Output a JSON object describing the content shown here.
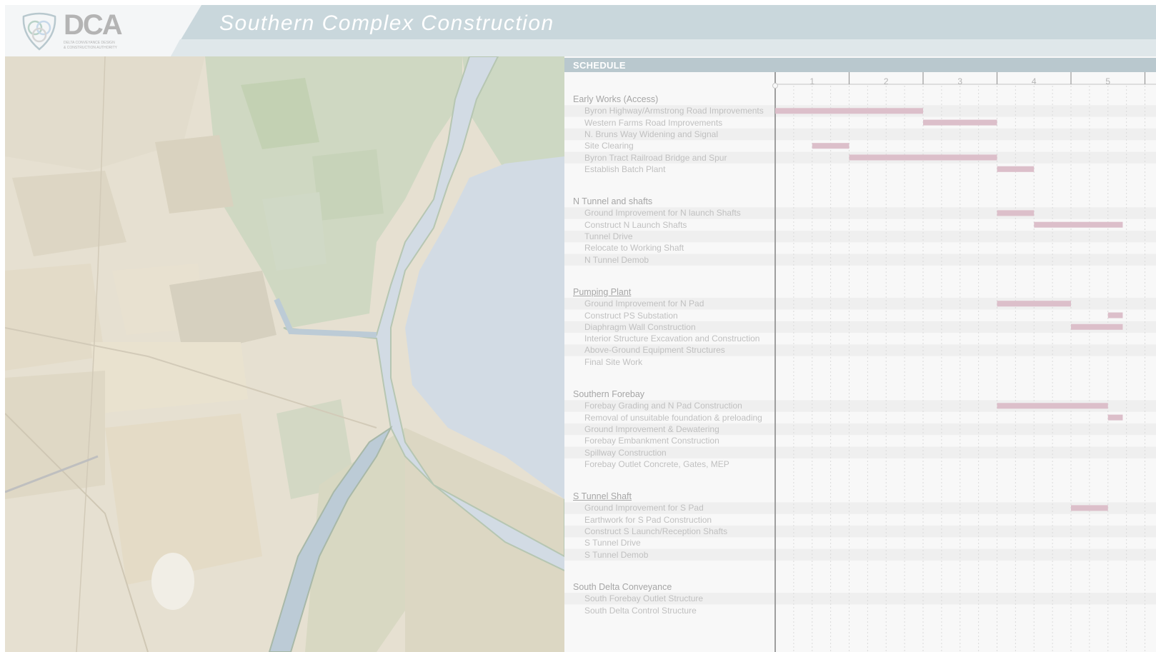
{
  "app": {
    "title": "Southern Complex Construction",
    "logo": {
      "name": "DCA",
      "subtitle_line1": "DELTA CONVEYANCE DESIGN",
      "subtitle_line2": "& CONSTRUCTION AUTHORITY"
    }
  },
  "colors": {
    "header_band": "#c9d7dc",
    "bar": "#dcbfca",
    "water": "#d2dbe4",
    "schedule_header": "#b9c8ce"
  },
  "schedule": {
    "title": "SCHEDULE",
    "periods": [
      "1",
      "2",
      "3",
      "4",
      "5"
    ],
    "groups": [
      {
        "name": "Early Works (Access)",
        "underline": false,
        "tasks": [
          {
            "name": "Byron Highway/Armstrong Road Improvements",
            "start": 0,
            "end": 2
          },
          {
            "name": "Western Farms Road Improvements",
            "start": 2,
            "end": 3
          },
          {
            "name": "N. Bruns Way Widening and Signal",
            "start": null,
            "end": null
          },
          {
            "name": "Site Clearing",
            "start": 0.5,
            "end": 1
          },
          {
            "name": "Byron Tract Railroad Bridge and Spur",
            "start": 1,
            "end": 3
          },
          {
            "name": "Establish Batch Plant",
            "start": 3,
            "end": 3.5
          }
        ]
      },
      {
        "name": "N Tunnel and shafts",
        "underline": false,
        "tasks": [
          {
            "name": "Ground Improvement for N launch Shafts",
            "start": 3,
            "end": 3.5
          },
          {
            "name": "Construct N Launch Shafts",
            "start": 3.5,
            "end": 4.7
          },
          {
            "name": "Tunnel Drive",
            "start": null,
            "end": null
          },
          {
            "name": "Relocate to Working Shaft",
            "start": null,
            "end": null
          },
          {
            "name": "N Tunnel Demob",
            "start": null,
            "end": null
          }
        ]
      },
      {
        "name": "Pumping Plant",
        "underline": true,
        "tasks": [
          {
            "name": "Ground Improvement for N Pad",
            "start": 3,
            "end": 4
          },
          {
            "name": "Construct PS Substation",
            "start": 4.5,
            "end": 4.7
          },
          {
            "name": "Diaphragm Wall Construction",
            "start": 4,
            "end": 4.7
          },
          {
            "name": "Interior Structure Excavation and Construction",
            "start": null,
            "end": null
          },
          {
            "name": "Above-Ground Equipment Structures",
            "start": null,
            "end": null
          },
          {
            "name": "Final Site Work",
            "start": null,
            "end": null
          }
        ]
      },
      {
        "name": "Southern Forebay",
        "underline": false,
        "tasks": [
          {
            "name": "Forebay Grading and N Pad Construction",
            "start": 3,
            "end": 4.5
          },
          {
            "name": "Removal of unsuitable foundation & preloading",
            "start": 4.5,
            "end": 4.7
          },
          {
            "name": "Ground Improvement & Dewatering",
            "start": null,
            "end": null
          },
          {
            "name": "Forebay Embankment Construction",
            "start": null,
            "end": null
          },
          {
            "name": "Spillway Construction",
            "start": null,
            "end": null
          },
          {
            "name": "Forebay Outlet Concrete, Gates, MEP",
            "start": null,
            "end": null
          }
        ]
      },
      {
        "name": "S Tunnel Shaft",
        "underline": true,
        "tasks": [
          {
            "name": "Ground Improvement for S Pad",
            "start": 4,
            "end": 4.5
          },
          {
            "name": "Earthwork for S Pad Construction",
            "start": null,
            "end": null
          },
          {
            "name": "Construct S Launch/Reception Shafts",
            "start": null,
            "end": null
          },
          {
            "name": "S Tunnel Drive",
            "start": null,
            "end": null
          },
          {
            "name": "S Tunnel Demob",
            "start": null,
            "end": null
          }
        ]
      },
      {
        "name": "South Delta Conveyance",
        "underline": false,
        "tasks": [
          {
            "name": "South Forebay Outlet Structure",
            "start": null,
            "end": null
          },
          {
            "name": "South Delta Control Structure",
            "start": null,
            "end": null
          }
        ]
      }
    ]
  }
}
